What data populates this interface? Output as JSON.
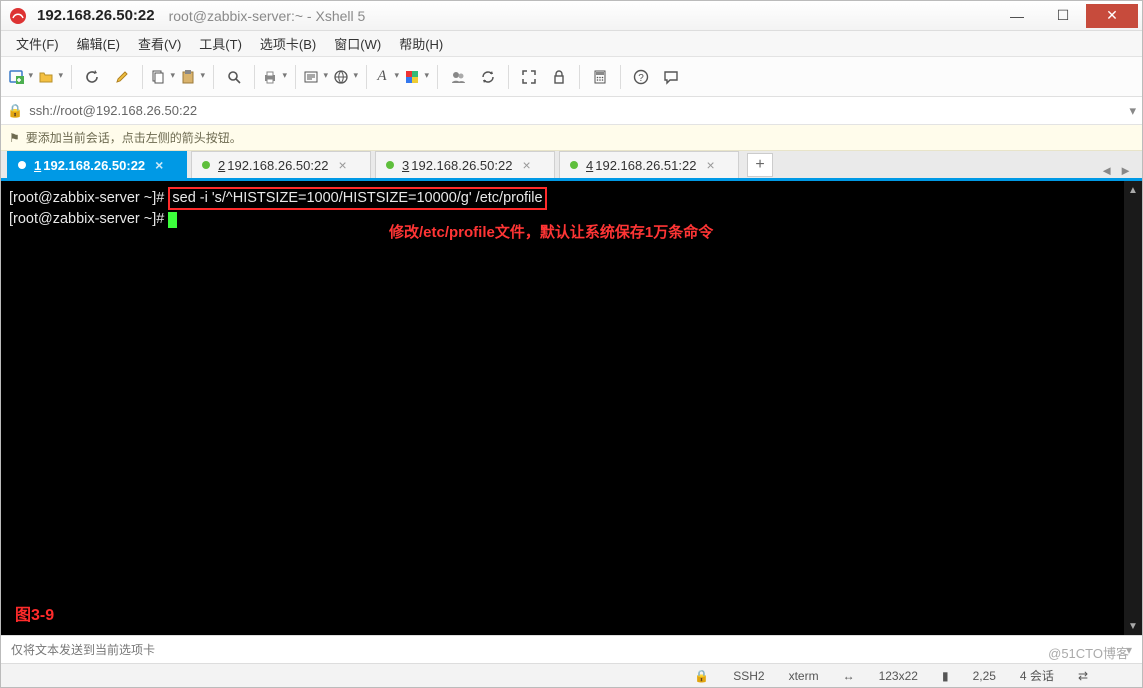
{
  "title": {
    "ip": "192.168.26.50:22",
    "sub": "root@zabbix-server:~ - Xshell 5"
  },
  "menu": {
    "file": "文件(F)",
    "edit": "编辑(E)",
    "view": "查看(V)",
    "tools": "工具(T)",
    "tabs": "选项卡(B)",
    "window": "窗口(W)",
    "help": "帮助(H)"
  },
  "address": {
    "url": "ssh://root@192.168.26.50:22"
  },
  "hint": {
    "text": "要添加当前会话，点击左侧的箭头按钮。"
  },
  "tabs": {
    "items": [
      {
        "num": "1",
        "label": "192.168.26.50:22"
      },
      {
        "num": "2",
        "label": "192.168.26.50:22"
      },
      {
        "num": "3",
        "label": "192.168.26.50:22"
      },
      {
        "num": "4",
        "label": "192.168.26.51:22"
      }
    ]
  },
  "terminal": {
    "prompt1": "[root@zabbix-server ~]# ",
    "cmd": "sed -i 's/^HISTSIZE=1000/HISTSIZE=10000/g' /etc/profile",
    "prompt2": "[root@zabbix-server ~]# ",
    "annot": "修改/etc/profile文件，默认让系统保存1万条命令",
    "fig": "图3-9"
  },
  "input_hint": "仅将文本发送到当前选项卡",
  "status": {
    "proto": "SSH2",
    "term": "xterm",
    "size": "123x22",
    "pos": "2,25",
    "sessions": "4 会话"
  },
  "watermark": "@51CTO博客",
  "icons": {
    "lock": "🔒",
    "flag": "⚑",
    "plus": "+",
    "left": "◄",
    "right": "►",
    "min": "—",
    "max": "☐",
    "close": "✕",
    "chev": "▾",
    "sz_arrows": "⇄",
    "lock2": "🔒",
    "sz_icon": "↔"
  }
}
